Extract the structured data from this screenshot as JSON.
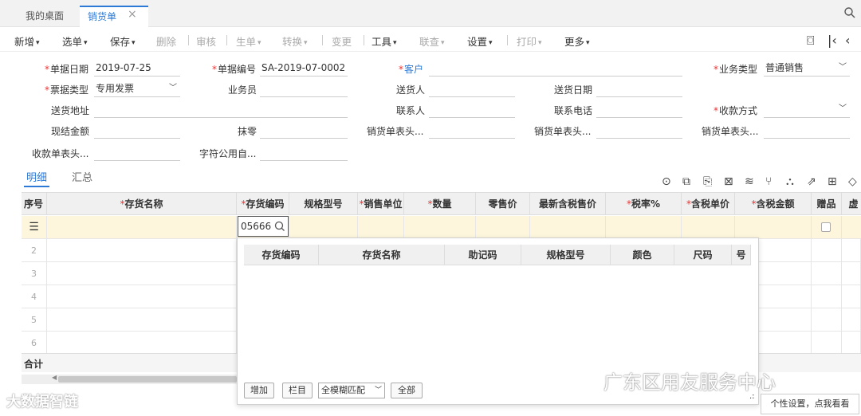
{
  "tabs": {
    "home": "我的桌面",
    "active": "销货单",
    "close": "×"
  },
  "toolbar": {
    "items": [
      {
        "label": "新增",
        "caret": true,
        "disabled": false
      },
      {
        "label": "选单",
        "caret": true,
        "disabled": false
      },
      {
        "label": "保存",
        "caret": true,
        "disabled": false
      },
      {
        "label": "删除",
        "caret": false,
        "disabled": true
      },
      {
        "label": "审核",
        "caret": false,
        "disabled": true
      },
      {
        "label": "生单",
        "caret": true,
        "disabled": true
      },
      {
        "label": "转换",
        "caret": true,
        "disabled": true
      },
      {
        "label": "变更",
        "caret": false,
        "disabled": true
      },
      {
        "label": "工具",
        "caret": true,
        "disabled": false
      },
      {
        "label": "联查",
        "caret": true,
        "disabled": true
      },
      {
        "label": "设置",
        "caret": true,
        "disabled": false
      },
      {
        "label": "打印",
        "caret": true,
        "disabled": true
      },
      {
        "label": "更多",
        "caret": true,
        "disabled": false
      }
    ]
  },
  "form": {
    "doc_date_label": "单据日期",
    "doc_date": "2019-07-25",
    "doc_no_label": "单据编号",
    "doc_no": "SA-2019-07-0002",
    "customer_label": "客户",
    "biz_type_label": "业务类型",
    "biz_type": "普通销售",
    "invoice_type_label": "票据类型",
    "invoice_type": "专用发票",
    "salesman_label": "业务员",
    "deliverer_label": "送货人",
    "delivery_date_label": "送货日期",
    "address_label": "送货地址",
    "contact_label": "联系人",
    "phone_label": "联系电话",
    "pay_method_label": "收款方式",
    "cash_amount_label": "现结金额",
    "rounding_label": "抹零",
    "header1_label": "销货单表头...",
    "header2_label": "销货单表头...",
    "header3_label": "销货单表头...",
    "receipt_header_label": "收款单表头...",
    "shared_label": "字符公用自..."
  },
  "detail_tabs": {
    "detail": "明细",
    "summary": "汇总"
  },
  "grid": {
    "columns": [
      {
        "label": "序号",
        "required": false
      },
      {
        "label": "存货名称",
        "required": true
      },
      {
        "label": "存货编码",
        "required": true
      },
      {
        "label": "规格型号",
        "required": false
      },
      {
        "label": "销售单位",
        "required": true
      },
      {
        "label": "数量",
        "required": true
      },
      {
        "label": "零售价",
        "required": false
      },
      {
        "label": "最新含税售价",
        "required": false
      },
      {
        "label": "税率%",
        "required": true
      },
      {
        "label": "含税单价",
        "required": true
      },
      {
        "label": "含税金额",
        "required": true
      },
      {
        "label": "赠品",
        "required": false
      },
      {
        "label": "虚",
        "required": false
      }
    ],
    "row_numbers": [
      "2",
      "3",
      "4",
      "5",
      "6"
    ],
    "sum_label": "合计",
    "code_input_value": "05666"
  },
  "popup": {
    "columns": [
      "存货编码",
      "存货名称",
      "助记码",
      "规格型号",
      "颜色",
      "尺码",
      "号"
    ],
    "add_button": "增加",
    "column_button": "栏目",
    "match_select": "全模糊匹配",
    "all_button": "全部"
  },
  "footer": {
    "personal_settings": "个性设置，点我看看",
    "watermark_left": "大数据智链",
    "watermark_right": "广东区用友服务中心"
  }
}
